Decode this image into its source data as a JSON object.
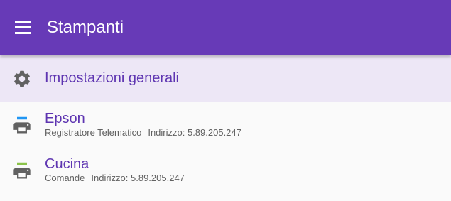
{
  "appbar": {
    "title": "Stampanti",
    "menu_icon": "menu-icon",
    "color": "#673ab7"
  },
  "general_settings": {
    "label": "Impostazioni generali",
    "icon": "gear-icon",
    "background": "#ede7f6"
  },
  "printers": [
    {
      "name": "Epson",
      "type": "Registratore Telematico",
      "address_label": "Indirizzo: 5.89.205.247",
      "icon": "printer-icon",
      "accent": "#2196f3"
    },
    {
      "name": "Cucina",
      "type": "Comande",
      "address_label": "Indirizzo: 5.89.205.247",
      "icon": "printer-icon",
      "accent": "#8bc34a"
    }
  ]
}
